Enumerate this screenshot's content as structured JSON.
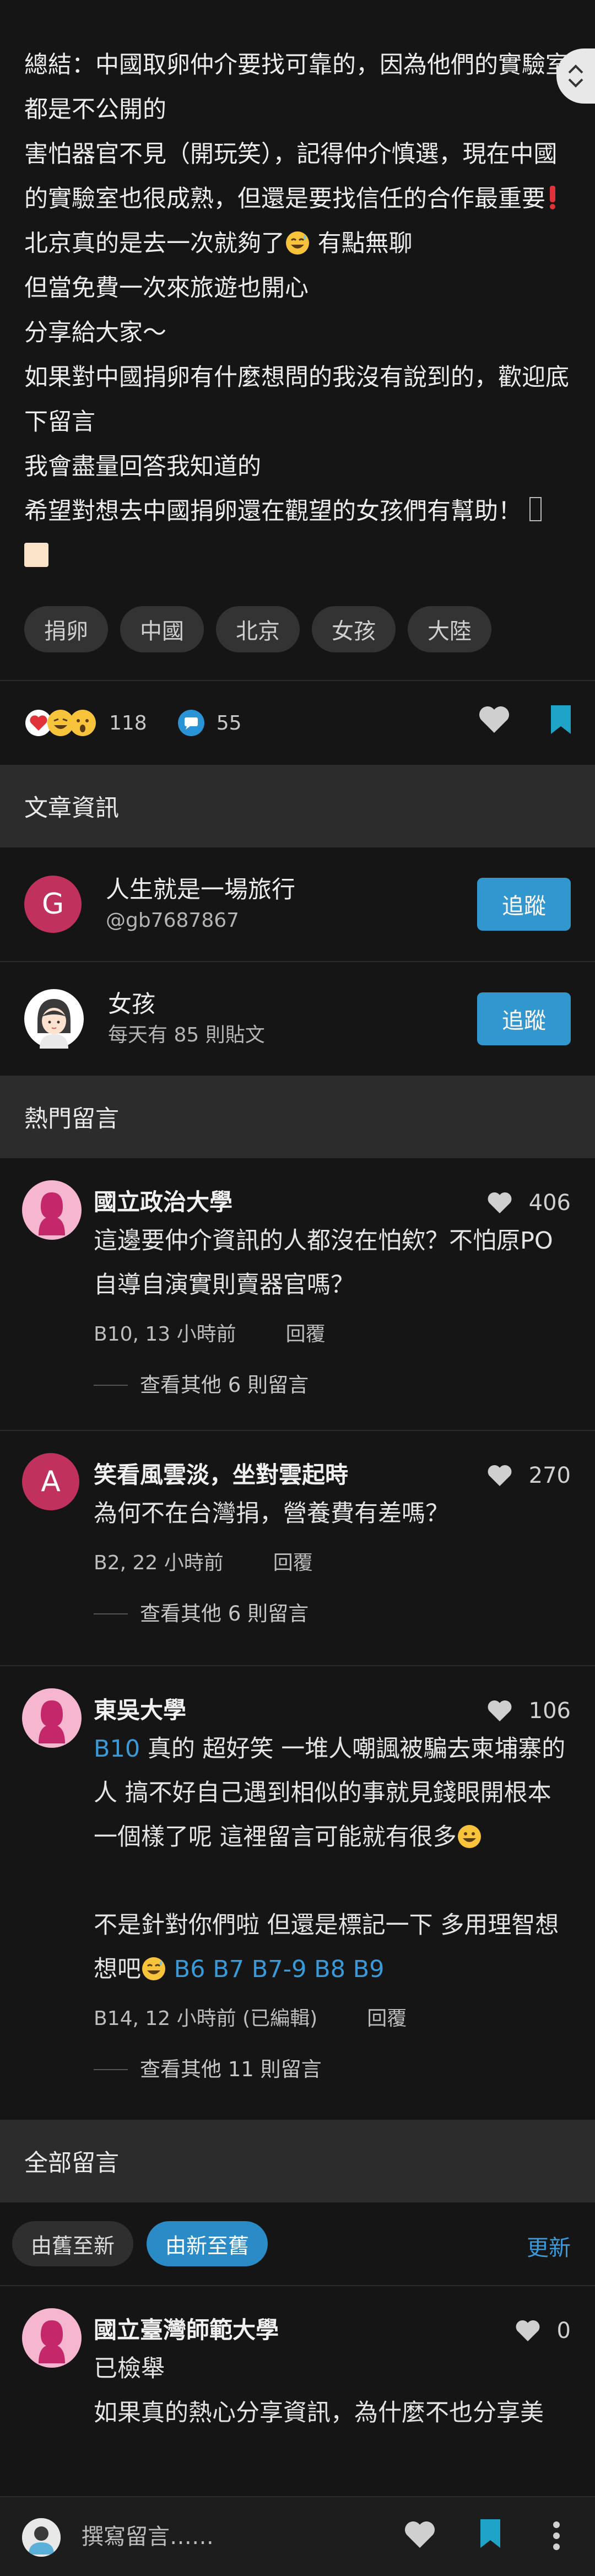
{
  "article": {
    "lines": [
      "總結：中國取卵仲介要找可靠的，因為他們的實驗室都是不公開的",
      "害怕器官不見（開玩笑），記得仲介慎選，現在中國的實驗室也很成熟，但還是要找信任的合作最重要",
      "北京真的是去一次就夠了",
      "有點無聊",
      "但當免費一次來旅遊也開心",
      "分享給大家〜",
      "如果對中國捐卵有什麼想問的我沒有說到的，歡迎底下留言",
      "我會盡量回答我知道的",
      "希望對想去中國捐卵還在觀望的女孩們有幫助！"
    ],
    "tags": [
      "捐卵",
      "中國",
      "北京",
      "女孩",
      "大陸"
    ]
  },
  "stats": {
    "reactions": "118",
    "comments": "55"
  },
  "colors": {
    "accent": "#3397cf",
    "avatar_red": "#c0315e",
    "bookmark": "#1fa3c7"
  },
  "article_info": {
    "header": "文章資訊",
    "author": {
      "initial": "G",
      "name": "人生就是一場旅行",
      "handle": "@gb7687867",
      "follow": "追蹤"
    },
    "board": {
      "name": "女孩",
      "sub": "每天有 85 則貼文",
      "follow": "追蹤"
    }
  },
  "hot_comments": {
    "header": "熱門留言",
    "items": [
      {
        "school": "國立政治大學",
        "likes": "406",
        "text": "這邊要仲介資訊的人都沒在怕欸？不怕原PO自導自演實則賣器官嗎？",
        "meta": "B10, 13 小時前",
        "reply": "回覆",
        "more": "查看其他 6 則留言"
      },
      {
        "initial": "A",
        "school": "笑看風雲淡，坐對雲起時",
        "likes": "270",
        "text": "為何不在台灣捐，營養費有差嗎？",
        "meta": "B2, 22 小時前",
        "reply": "回覆",
        "more": "查看其他 6 則留言"
      },
      {
        "school": "東吳大學",
        "likes": "106",
        "link1": "B10",
        "text1": " 真的 超好笑 一堆人嘲諷被騙去柬埔寨的人 搞不好自己遇到相似的事就見錢眼開根本一個樣了呢 這裡留言可能就有很多",
        "text2": "不是針對你們啦 但還是標記一下 多用理智想想吧",
        "links2": "B6 B7 B7-9 B8 B9",
        "meta": "B14, 12 小時前 (已編輯)",
        "reply": "回覆",
        "more": "查看其他 11 則留言"
      }
    ]
  },
  "all_comments": {
    "header": "全部留言",
    "sort_old": "由舊至新",
    "sort_new": "由新至舊",
    "refresh": "更新",
    "first": {
      "school": "國立臺灣師範大學",
      "likes": "0",
      "line1": "已檢舉",
      "line2": "如果真的熱心分享資訊，為什麼不也分享美"
    }
  },
  "bottom_bar": {
    "placeholder": "撰寫留言……"
  },
  "icons": {
    "scroll": "chevron-up-down-icon",
    "like": "heart-icon",
    "bookmark": "bookmark-icon",
    "comment": "comment-bubble-icon",
    "more": "more-vertical-icon"
  }
}
